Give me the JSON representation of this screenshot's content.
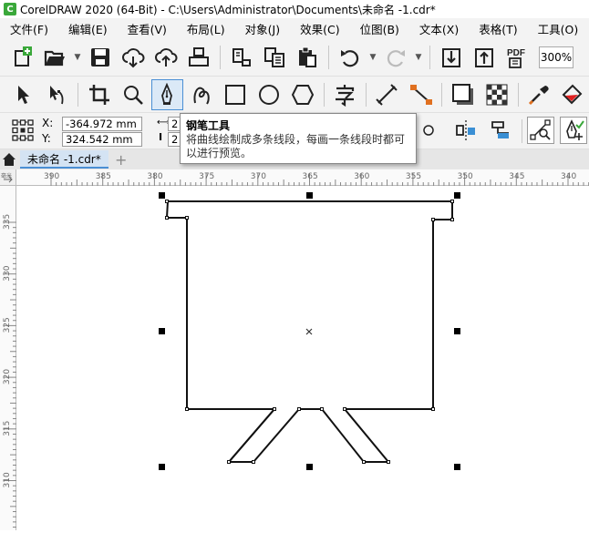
{
  "window": {
    "title": "CorelDRAW 2020 (64-Bit) - C:\\Users\\Administrator\\Documents\\未命名 -1.cdr*",
    "app_icon_letter": "C"
  },
  "menu": {
    "items": [
      "文件(F)",
      "编辑(E)",
      "查看(V)",
      "布局(L)",
      "对象(J)",
      "效果(C)",
      "位图(B)",
      "文本(X)",
      "表格(T)",
      "工具(O)"
    ]
  },
  "standard_toolbar": {
    "zoom_value": "300%",
    "pdf_label": "PDF"
  },
  "property_bar": {
    "x_label": "X:",
    "x_value": "-364.972 mm",
    "y_label": "Y:",
    "y_value": "324.542 mm",
    "w_value": "2",
    "h_value": "2"
  },
  "tooltip": {
    "title": "钢笔工具",
    "description": "将曲线绘制成多条线段，每画一条线段时都可以进行预览。"
  },
  "tabs": {
    "document_tab": "未命名 -1.cdr*"
  },
  "rulers": {
    "horizontal_labels": [
      "390",
      "385",
      "380",
      "375",
      "370",
      "365",
      "360",
      "355",
      "350",
      "345",
      "340"
    ],
    "vertical_labels": [
      "335",
      "330",
      "325",
      "320",
      "315",
      "310"
    ],
    "corner_label": "毫米"
  },
  "colors": {
    "accent": "#4a8fd4",
    "toolbar_bg": "#f3f3f3",
    "app_icon": "#3aa83a"
  }
}
